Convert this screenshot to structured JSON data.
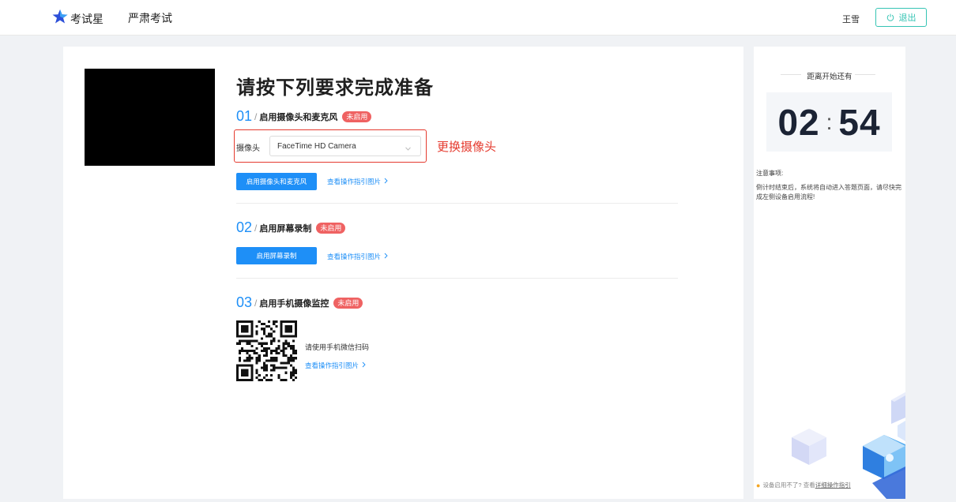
{
  "topbar": {
    "logo_text": "考试星",
    "exam_name": "严肃考试",
    "username": "王雪",
    "logout_label": "退出"
  },
  "main": {
    "heading": "请按下列要求完成准备",
    "steps": [
      {
        "num": "01",
        "title": "启用摄像头和麦克风",
        "badge": "未启用",
        "button": "启用摄像头和麦克风",
        "guide": "查看操作指引图片"
      },
      {
        "num": "02",
        "title": "启用屏幕录制",
        "badge": "未启用",
        "button": "启用屏幕录制",
        "guide": "查看操作指引图片"
      },
      {
        "num": "03",
        "title": "启用手机摄像监控",
        "badge": "未启用",
        "scan_text": "请使用手机微信扫码",
        "guide": "查看操作指引图片"
      }
    ],
    "camera": {
      "label": "摄像头",
      "selected": "FaceTime HD Camera",
      "switch_hint": "更换摄像头"
    },
    "slash": "/"
  },
  "sidebar": {
    "countdown_title": "距离开始还有",
    "minutes": "02",
    "colon": ":",
    "seconds": "54",
    "notice_title": "注意事项:",
    "notice_body": "倒计时结束后，系统将自动进入答题页面，请尽快完成左侧设备启用流程!",
    "help_prefix": "设备启用不了? 查看",
    "help_link": "详细操作指引"
  },
  "colors": {
    "accent": "#1e8ff7",
    "danger": "#ef6262",
    "highlight": "#e53b2f",
    "teal": "#36c4b4"
  },
  "icons": [
    "star-logo-icon",
    "power-icon",
    "chevron-down-icon",
    "chevron-right-icon",
    "qr-code-icon"
  ]
}
